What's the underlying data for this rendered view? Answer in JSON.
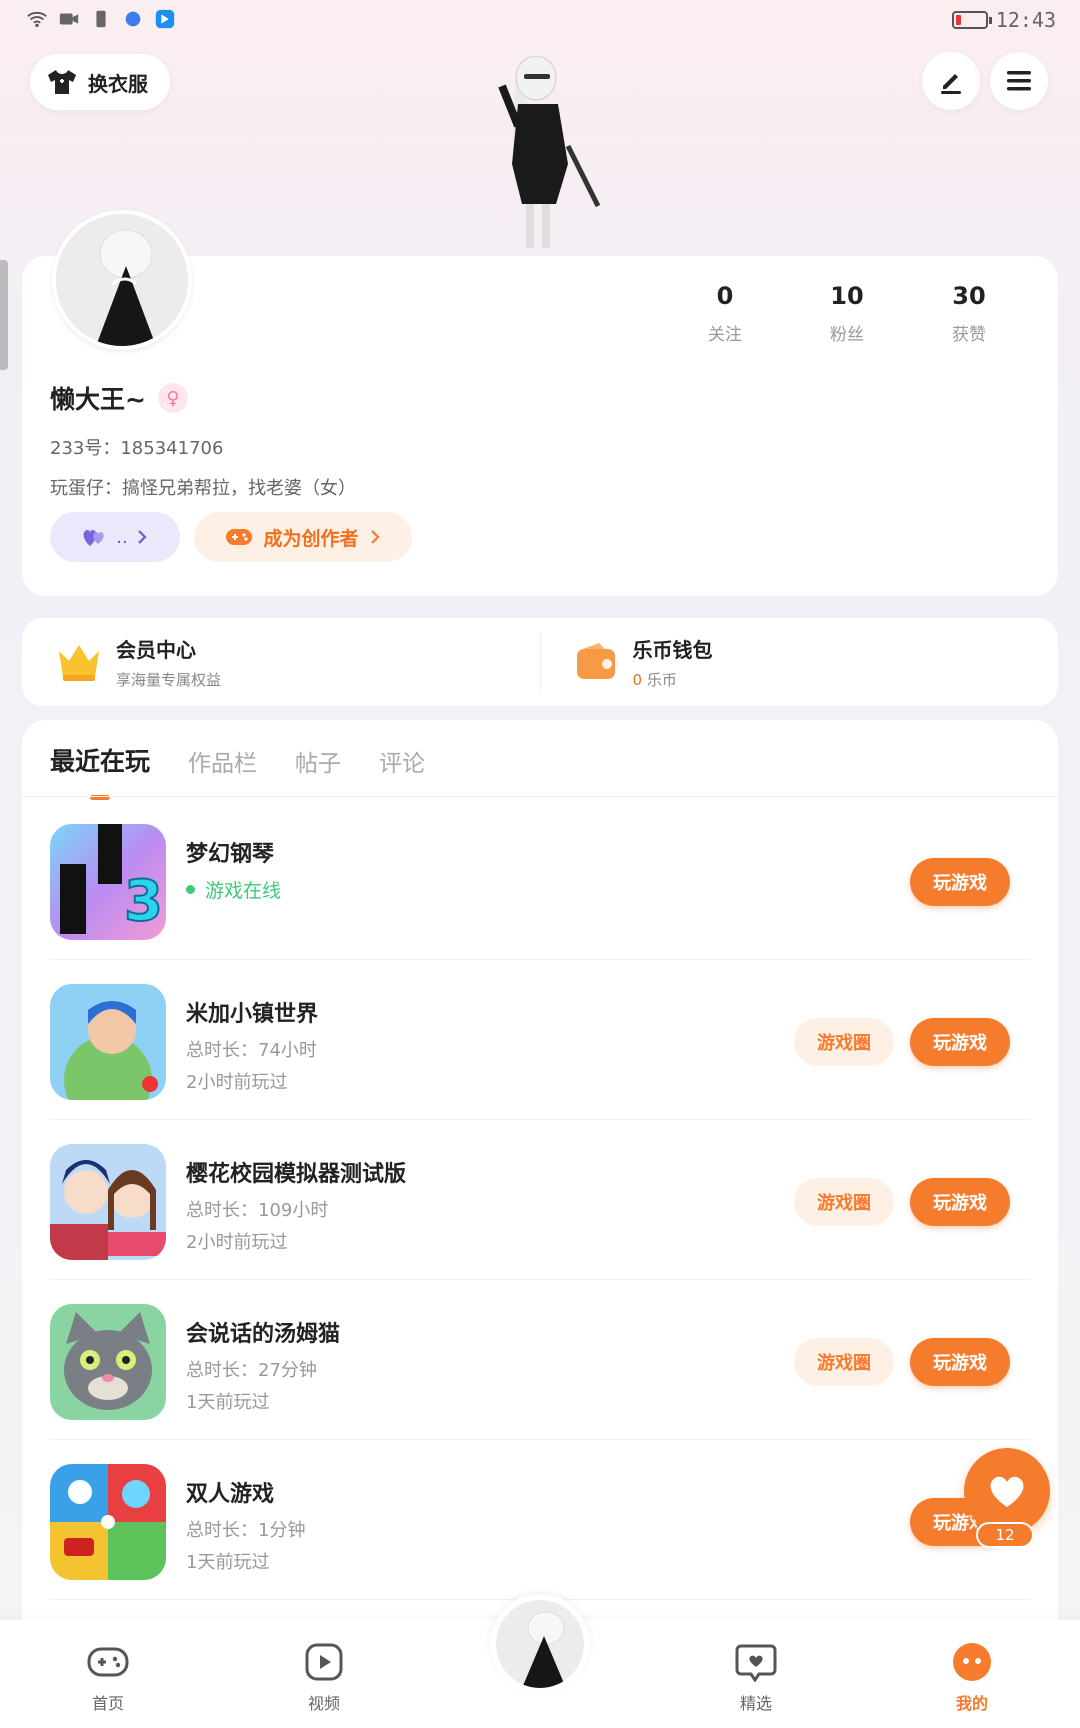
{
  "status_bar": {
    "time": "12:43"
  },
  "header": {
    "outfit_label": "换衣服"
  },
  "profile": {
    "stats": [
      {
        "value": "0",
        "label": "关注"
      },
      {
        "value": "10",
        "label": "粉丝"
      },
      {
        "value": "30",
        "label": "获赞"
      }
    ],
    "username": "懒大王~",
    "gender_symbol": "♀",
    "uid": "233号：185341706",
    "bio": "玩蛋仔：搞怪兄弟帮拉，找老婆（女）",
    "purple_pill_text": "..",
    "creator_label": "成为创作者"
  },
  "member": {
    "title": "会员中心",
    "subtitle": "享海量专属权益"
  },
  "wallet": {
    "title": "乐币钱包",
    "amount": "0",
    "unit": "乐币"
  },
  "tabs": [
    "最近在玩",
    "作品栏",
    "帖子",
    "评论"
  ],
  "games": [
    {
      "name": "梦幻钢琴",
      "status": "游戏在线",
      "play_label": "玩游戏"
    },
    {
      "name": "米加小镇世界",
      "duration": "总时长：74小时",
      "last_played": "2小时前玩过",
      "circle_label": "游戏圈",
      "play_label": "玩游戏"
    },
    {
      "name": "樱花校园模拟器测试版",
      "duration": "总时长：109小时",
      "last_played": "2小时前玩过",
      "circle_label": "游戏圈",
      "play_label": "玩游戏"
    },
    {
      "name": "会说话的汤姆猫",
      "duration": "总时长：27分钟",
      "last_played": "1天前玩过",
      "circle_label": "游戏圈",
      "play_label": "玩游戏"
    },
    {
      "name": "双人游戏",
      "duration": "总时长：1分钟",
      "last_played": "1天前玩过",
      "play_label": "玩游戏"
    }
  ],
  "floating_like": {
    "count": "12"
  },
  "bottom_nav": [
    {
      "label": "首页",
      "icon": "gamepad-icon"
    },
    {
      "label": "视频",
      "icon": "play-icon"
    },
    {
      "label": "精选",
      "icon": "heart-chat-icon"
    },
    {
      "label": "我的",
      "icon": "face-icon"
    }
  ],
  "colors": {
    "accent": "#f57b2d",
    "online": "#3ecb78",
    "purple": "#6a58d6"
  }
}
